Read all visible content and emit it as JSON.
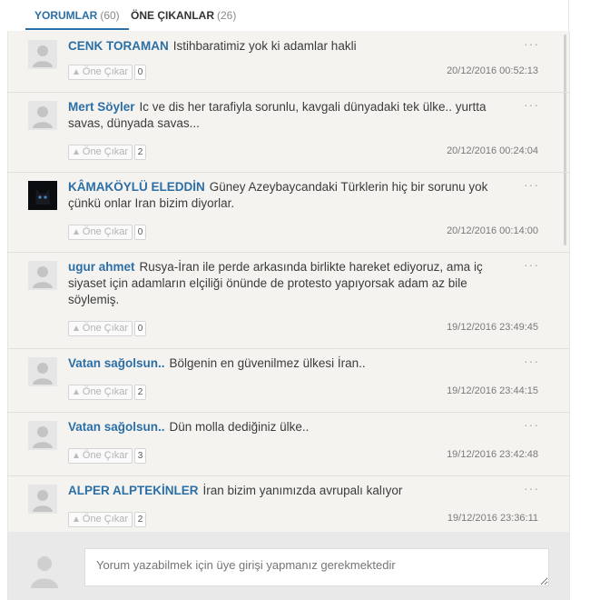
{
  "tabs": [
    {
      "label": "YORUMLAR",
      "count": "(60)"
    },
    {
      "label": "ÖNE ÇIKANLAR",
      "count": "(26)"
    }
  ],
  "like_button_label": "Öne Çıkar",
  "more_icon": "···",
  "comments": [
    {
      "author": "CENK TORAMAN",
      "text": "Istihbaratimiz yok ki adamlar hakli",
      "likes": "0",
      "date": "20/12/2016 00:52:13"
    },
    {
      "author": "Mert Söyler",
      "text": "Ic ve dis her tarafiyla sorunlu, kavgali dünyadaki tek ülke.. yurtta savas, dünyada savas...",
      "likes": "2",
      "date": "20/12/2016 00:24:04"
    },
    {
      "author": "KÂMAKÖYLÜ ELEDDİN",
      "text": "Güney Azeybaycandaki Türklerin hiç bir sorunu yok çünkü onlar Iran bizim diyorlar.",
      "likes": "0",
      "date": "20/12/2016 00:14:00"
    },
    {
      "author": "ugur ahmet",
      "text": "Rusya-İran ile perde arkasında birlikte hareket ediyoruz, ama iç siyaset için adamların elçiliği önünde de protesto yapıyorsak adam az bile söylemiş.",
      "likes": "0",
      "date": "19/12/2016 23:49:45"
    },
    {
      "author": "Vatan sağolsun..",
      "text": "Bölgenin en güvenilmez ülkesi İran..",
      "likes": "2",
      "date": "19/12/2016 23:44:15"
    },
    {
      "author": "Vatan sağolsun..",
      "text": "Dün molla dediğiniz ülke..",
      "likes": "3",
      "date": "19/12/2016 23:42:48"
    },
    {
      "author": "ALPER ALPTEKİNLER",
      "text": "İran bizim yanımızda avrupalı kalıyor",
      "likes": "2",
      "date": "19/12/2016 23:36:11"
    }
  ],
  "compose": {
    "placeholder": "Yorum yazabilmek için üye girişi yapmanız gerekmektedir"
  }
}
